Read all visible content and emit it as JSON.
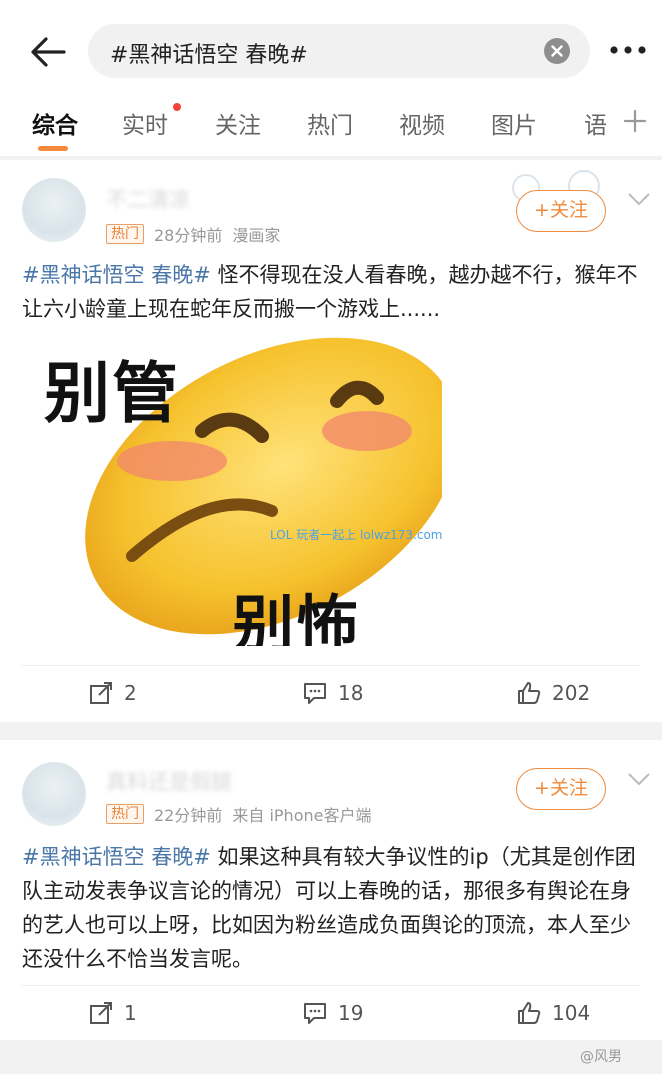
{
  "search": {
    "query": "#黑神话悟空 春晚#"
  },
  "tabs": [
    "综合",
    "实时",
    "关注",
    "热门",
    "视频",
    "图片",
    "语"
  ],
  "posts": [
    {
      "username": "不二清凉",
      "badge": "热门",
      "time": "28分钟前",
      "source": "漫画家",
      "follow": "+关注",
      "tag": "#黑神话悟空 春晚#",
      "text": " 怪不得现在没人看春晚，越办越不行，猴年不让六小龄童上现在蛇年反而搬一个游戏上......",
      "image_text_top": "别管",
      "image_text_bottom": "别怖",
      "watermark": "LOL 玩者一起上 lolwz173.com",
      "shares": "2",
      "comments": "18",
      "likes": "202"
    },
    {
      "username": "真料还是假腿",
      "badge": "热门",
      "time": "22分钟前",
      "source": "来自 iPhone客户端",
      "follow": "+关注",
      "tag": "#黑神话悟空 春晚#",
      "text": " 如果这种具有较大争议性的ip（尤其是创作团队主动发表争议言论的情况）可以上春晚的话，那很多有舆论在身的艺人也可以上呀，比如因为粉丝造成负面舆论的顶流，本人至少还没什么不恰当发言呢。",
      "shares": "1",
      "comments": "19",
      "likes": "104"
    }
  ],
  "footer": {
    "watermark": "@风男"
  },
  "colors": {
    "accent": "#f08a3c",
    "tag": "#4a77a8",
    "emoji": "#f6c22e"
  }
}
